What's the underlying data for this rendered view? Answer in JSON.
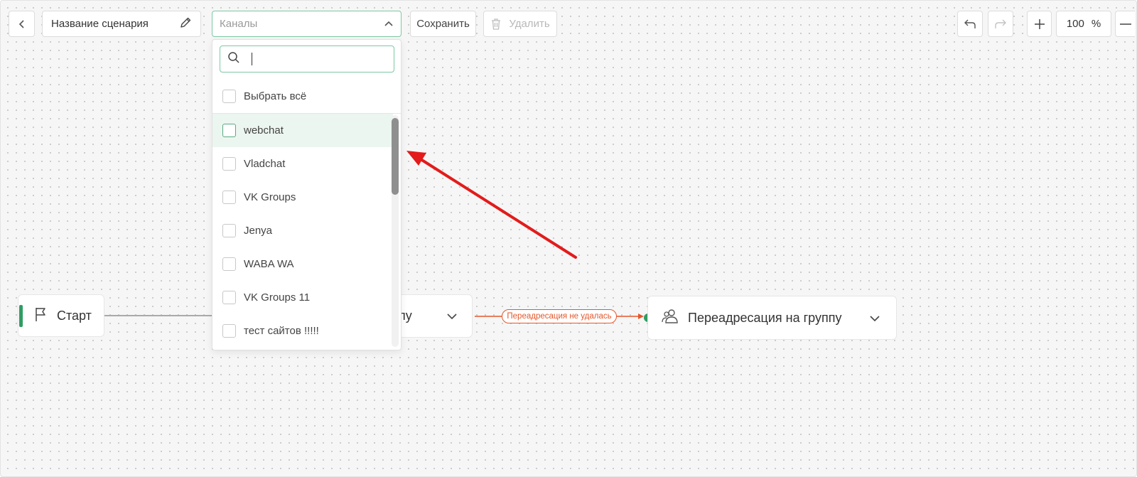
{
  "toolbar": {
    "back_icon": "chevron-left-icon",
    "scenario_name": "Название сценария",
    "edit_icon": "pencil-icon",
    "channels_placeholder": "Каналы",
    "save_label": "Сохранить",
    "delete_label": "Удалить",
    "delete_icon": "trash-icon",
    "undo_icon": "undo-icon",
    "redo_icon": "redo-icon",
    "zoom_in_icon": "plus-icon",
    "zoom_value": "100",
    "zoom_unit": "%",
    "zoom_out_icon": "minus-icon"
  },
  "dropdown": {
    "search_value": "",
    "select_all": "Выбрать всё",
    "items": [
      {
        "label": "webchat",
        "checked": false,
        "highlighted": true
      },
      {
        "label": "Vladchat",
        "checked": false
      },
      {
        "label": "VK Groups",
        "checked": false
      },
      {
        "label": "Jenya",
        "checked": false
      },
      {
        "label": "WABA WA",
        "checked": false
      },
      {
        "label": "VK Groups 11",
        "checked": false
      },
      {
        "label": "тест сайтов !!!!!",
        "checked": false
      }
    ]
  },
  "nodes": {
    "start": {
      "label": "Старт",
      "icon": "flag-icon"
    },
    "middle": {
      "label_fragment": "пу",
      "icon": "chevron-down-icon"
    },
    "group_redirect": {
      "label": "Переадресация на группу",
      "icon": "users-icon"
    }
  },
  "edge": {
    "label": "Переадресация не удалась"
  },
  "colors": {
    "accent": "#2e9e62",
    "error": "#e5572a",
    "annotation_arrow": "#e31b1b",
    "highlight": "#ecf6f0"
  }
}
